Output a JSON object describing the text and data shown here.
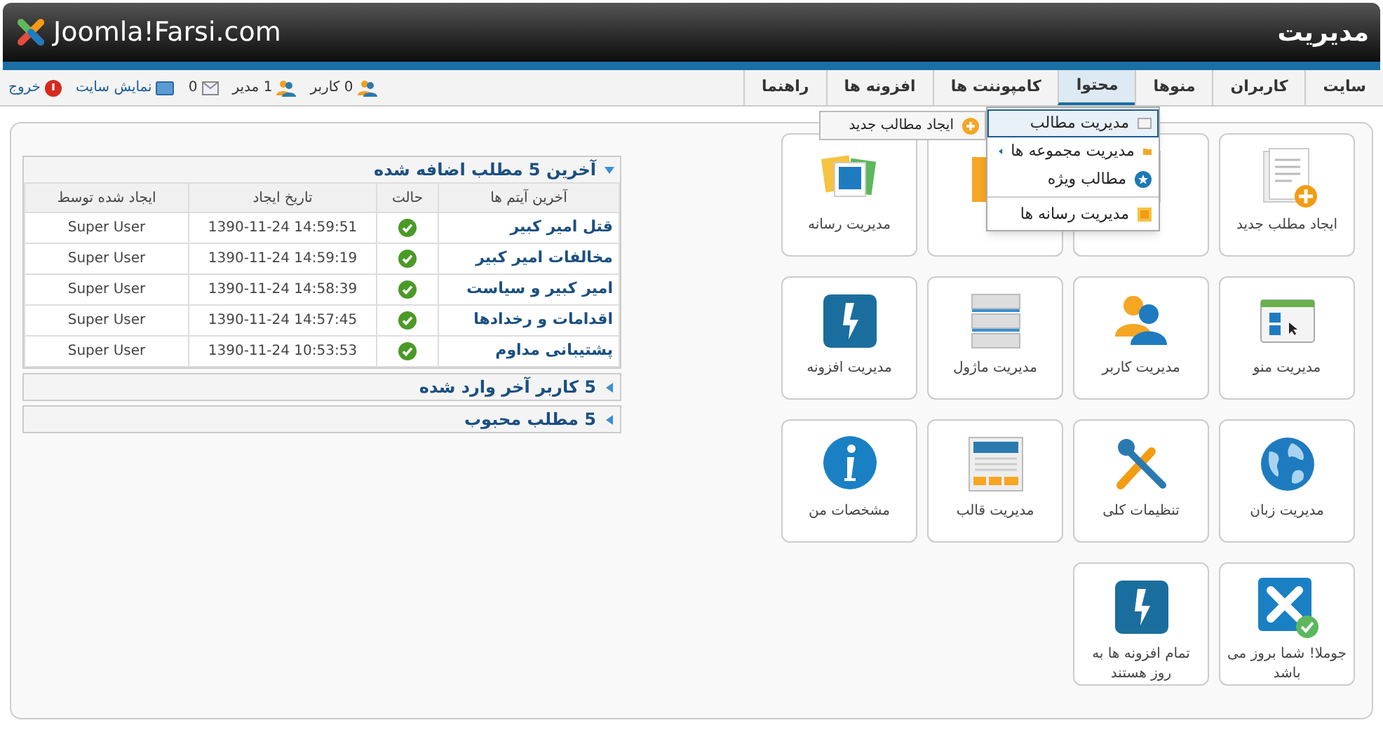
{
  "header": {
    "logo": "Joomla!Farsi.com",
    "title": "مدیریت"
  },
  "menu": [
    {
      "label": "سایت",
      "selected": false
    },
    {
      "label": "کاربران",
      "selected": false
    },
    {
      "label": "منوها",
      "selected": false
    },
    {
      "label": "محتوا",
      "selected": true
    },
    {
      "label": "کامپوننت ها",
      "selected": false
    },
    {
      "label": "افزونه ها",
      "selected": false
    },
    {
      "label": "راهنما",
      "selected": false
    }
  ],
  "status": [
    {
      "kind": "users",
      "label": "0 کاربر"
    },
    {
      "kind": "admins",
      "label": "1 مدیر"
    },
    {
      "kind": "messages",
      "label": "0"
    },
    {
      "kind": "view-site",
      "label": "نمایش سایت"
    },
    {
      "kind": "logout",
      "label": "خروج"
    }
  ],
  "dropdown": {
    "items": [
      {
        "kind": "articles",
        "label": "مدیریت مطالب",
        "selected": true,
        "has_submenu": false,
        "divider_above": false
      },
      {
        "kind": "categories",
        "label": "مدیریت مجموعه ها",
        "selected": false,
        "has_submenu": true,
        "divider_above": false
      },
      {
        "kind": "featured",
        "label": "مطالب ویژه",
        "selected": false,
        "has_submenu": false,
        "divider_above": false
      },
      {
        "kind": "media",
        "label": "مدیریت رسانه ها",
        "selected": false,
        "has_submenu": false,
        "divider_above": true
      }
    ],
    "submenu": [
      {
        "kind": "add",
        "label": "ایجاد مطالب جدید"
      }
    ]
  },
  "cards": [
    {
      "kind": "new-article",
      "label": "ایجاد مطلب جدید"
    },
    {
      "kind": "articles"
    },
    {
      "kind": "categories"
    },
    {
      "kind": "media",
      "label": "مدیریت رسانه"
    },
    {
      "kind": "menus",
      "label": "مدیریت منو"
    },
    {
      "kind": "users",
      "label": "مدیریت کاربر"
    },
    {
      "kind": "modules",
      "label": "مدیریت ماژول"
    },
    {
      "kind": "extensions",
      "label": "مدیریت افزونه"
    },
    {
      "kind": "language",
      "label": "مدیریت زبان"
    },
    {
      "kind": "config",
      "label": "تنظیمات کلی"
    },
    {
      "kind": "template",
      "label": "مدیریت قالب"
    },
    {
      "kind": "info",
      "label": "مشخصات من"
    },
    {
      "kind": "joomla-update",
      "label": "جوملا! شما بروز می باشد"
    },
    {
      "kind": "extensions",
      "label": "تمام افزونه ها به روز هستند"
    }
  ],
  "modules": [
    {
      "title": "آخرین 5 مطلب اضافه شده",
      "expanded": true,
      "table": {
        "columns": [
          "آخرین آیتم ها",
          "حالت",
          "تاریخ ایجاد",
          "ایجاد شده توسط"
        ],
        "rows": [
          {
            "title": "قتل امیر کبیر",
            "published": true,
            "date": "1390-11-24 14:59:51",
            "author": "Super User"
          },
          {
            "title": "مخالفات امیر کبیر",
            "published": true,
            "date": "1390-11-24 14:59:19",
            "author": "Super User"
          },
          {
            "title": "امیر کبیر و سیاست",
            "published": true,
            "date": "1390-11-24 14:58:39",
            "author": "Super User"
          },
          {
            "title": "اقدامات و رخدادها",
            "published": true,
            "date": "1390-11-24 14:57:45",
            "author": "Super User"
          },
          {
            "title": "پشتیبانی مداوم",
            "published": true,
            "date": "1390-11-24 10:53:53",
            "author": "Super User"
          }
        ]
      }
    },
    {
      "title": "5 کاربر آخر وارد شده",
      "expanded": false
    },
    {
      "title": "5 مطلب محبوب",
      "expanded": false
    }
  ]
}
